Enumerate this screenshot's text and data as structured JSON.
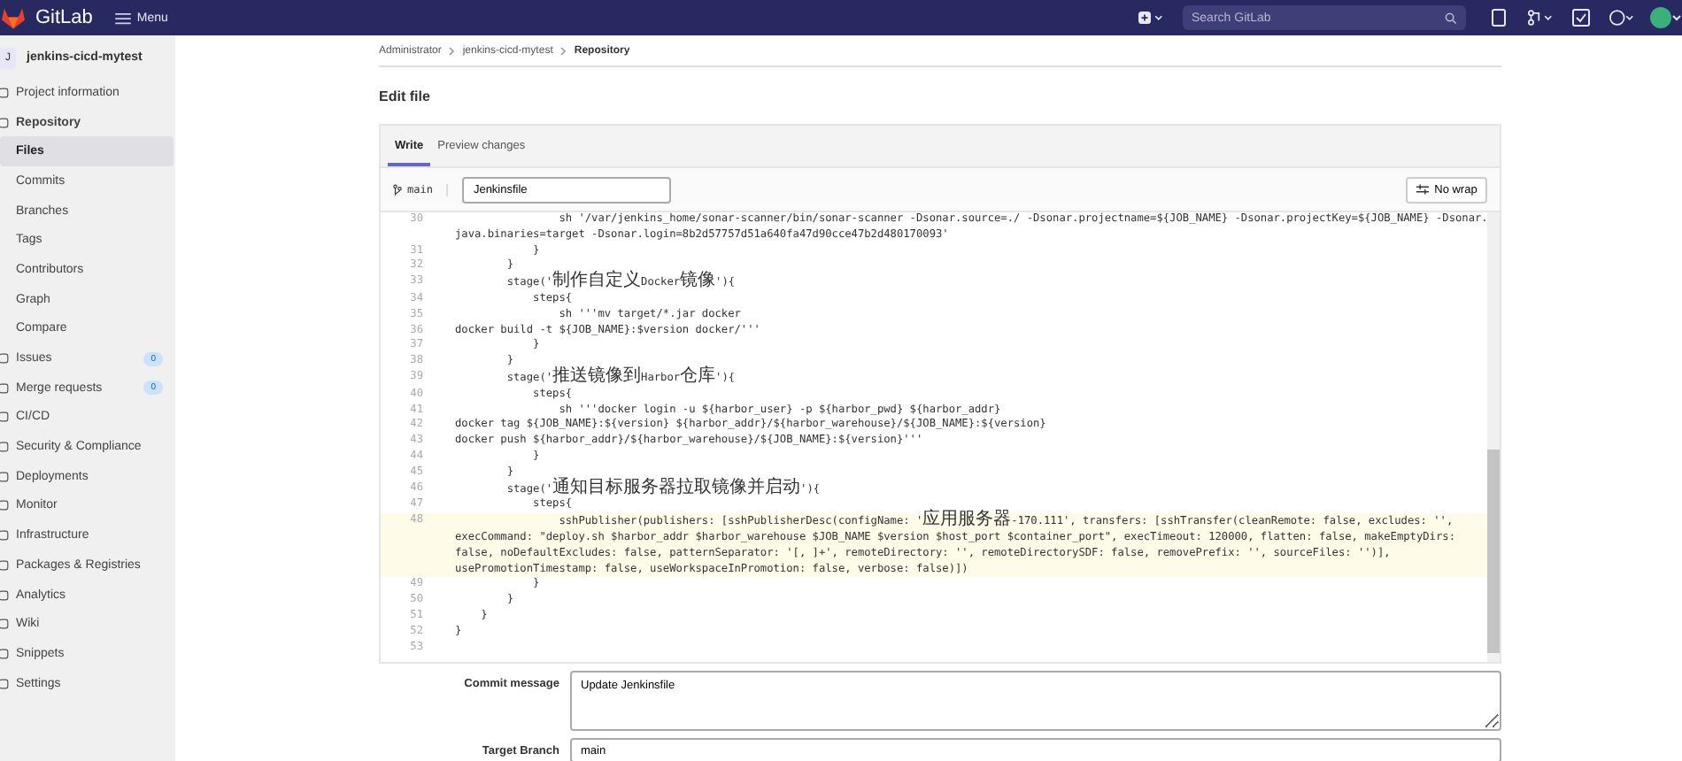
{
  "top_bar": {
    "brand": "GitLab",
    "menu": "Menu",
    "search": {
      "placeholder": "Search GitLab"
    }
  },
  "sidebar": {
    "project_avatar": "J",
    "project_name": "jenkins-cicd-mytest",
    "items": [
      {
        "label": "Project information",
        "kind": "section",
        "selected": false,
        "expanded": false
      },
      {
        "label": "Repository",
        "kind": "section",
        "selected": false,
        "expanded": true
      },
      {
        "label": "Files",
        "kind": "sub",
        "selected": true
      },
      {
        "label": "Commits",
        "kind": "sub",
        "selected": false
      },
      {
        "label": "Branches",
        "kind": "sub",
        "selected": false
      },
      {
        "label": "Tags",
        "kind": "sub",
        "selected": false
      },
      {
        "label": "Contributors",
        "kind": "sub",
        "selected": false
      },
      {
        "label": "Graph",
        "kind": "sub",
        "selected": false
      },
      {
        "label": "Compare",
        "kind": "sub",
        "selected": false
      },
      {
        "label": "Issues",
        "kind": "section",
        "selected": false,
        "expanded": false,
        "badge": "0"
      },
      {
        "label": "Merge requests",
        "kind": "section",
        "selected": false,
        "expanded": false,
        "badge": "0"
      },
      {
        "label": "CI/CD",
        "kind": "section",
        "selected": false,
        "expanded": false
      },
      {
        "label": "Security & Compliance",
        "kind": "section",
        "selected": false,
        "expanded": false
      },
      {
        "label": "Deployments",
        "kind": "section",
        "selected": false,
        "expanded": false
      },
      {
        "label": "Monitor",
        "kind": "section",
        "selected": false,
        "expanded": false
      },
      {
        "label": "Infrastructure",
        "kind": "section",
        "selected": false,
        "expanded": false
      },
      {
        "label": "Packages & Registries",
        "kind": "section",
        "selected": false,
        "expanded": false
      },
      {
        "label": "Analytics",
        "kind": "section",
        "selected": false,
        "expanded": false
      },
      {
        "label": "Wiki",
        "kind": "section",
        "selected": false,
        "expanded": false
      },
      {
        "label": "Snippets",
        "kind": "section",
        "selected": false,
        "expanded": false
      },
      {
        "label": "Settings",
        "kind": "section",
        "selected": false,
        "expanded": false
      }
    ]
  },
  "breadcrumb": [
    "Administrator",
    "jenkins-cicd-mytest",
    "Repository"
  ],
  "page_title": "Edit file",
  "editor": {
    "tabs": [
      {
        "label": "Write",
        "selected": true
      },
      {
        "label": "Preview changes",
        "selected": false
      }
    ],
    "branch": "main",
    "file_name": "Jenkinsfile",
    "wrap_button": "No wrap",
    "lines": [
      {
        "number": "30",
        "active": false,
        "segments": [
          "                sh '/var/jenkins_home/sonar-scanner/bin/sonar-scanner -Dsonar.source=./ -Dsonar.projectname=${JOB_NAME} -Dsonar.projectKey=${JOB_NAME} -Dsonar.",
          "java.binaries=target -Dsonar.login=8b2d57757d51a640fa47d90cce47b2d480170093'"
        ]
      },
      {
        "number": "31",
        "active": false,
        "segments": [
          "            }"
        ]
      },
      {
        "number": "32",
        "active": false,
        "segments": [
          "        }"
        ]
      },
      {
        "number": "33",
        "active": false,
        "segments": [
          "        stage('制作自定义Docker镜像'){"
        ]
      },
      {
        "number": "34",
        "active": false,
        "segments": [
          "            steps{"
        ]
      },
      {
        "number": "35",
        "active": false,
        "segments": [
          "                sh '''mv target/*.jar docker"
        ]
      },
      {
        "number": "36",
        "active": false,
        "segments": [
          "docker build -t ${JOB_NAME}:$version docker/'''"
        ]
      },
      {
        "number": "37",
        "active": false,
        "segments": [
          "            }"
        ]
      },
      {
        "number": "38",
        "active": false,
        "segments": [
          "        }"
        ]
      },
      {
        "number": "39",
        "active": false,
        "segments": [
          "        stage('推送镜像到Harbor仓库'){"
        ]
      },
      {
        "number": "40",
        "active": false,
        "segments": [
          "            steps{"
        ]
      },
      {
        "number": "41",
        "active": false,
        "segments": [
          "                sh '''docker login -u ${harbor_user} -p ${harbor_pwd} ${harbor_addr}"
        ]
      },
      {
        "number": "42",
        "active": false,
        "segments": [
          "docker tag ${JOB_NAME}:${version} ${harbor_addr}/${harbor_warehouse}/${JOB_NAME}:${version}"
        ]
      },
      {
        "number": "43",
        "active": false,
        "segments": [
          "docker push ${harbor_addr}/${harbor_warehouse}/${JOB_NAME}:${version}'''"
        ]
      },
      {
        "number": "44",
        "active": false,
        "segments": [
          "            }"
        ]
      },
      {
        "number": "45",
        "active": false,
        "segments": [
          "        }"
        ]
      },
      {
        "number": "46",
        "active": false,
        "segments": [
          "        stage('通知目标服务器拉取镜像并启动'){"
        ]
      },
      {
        "number": "47",
        "active": false,
        "segments": [
          "            steps{"
        ]
      },
      {
        "number": "48",
        "active": true,
        "segments": [
          "                sshPublisher(publishers: [sshPublisherDesc(configName: '应用服务器-170.111', transfers: [sshTransfer(cleanRemote: false, excludes: '',",
          "execCommand: \"deploy.sh $harbor_addr $harbor_warehouse $JOB_NAME $version $host_port $container_port\", execTimeout: 120000, flatten: false, makeEmptyDirs:",
          "false, noDefaultExcludes: false, patternSeparator: '[, ]+', remoteDirectory: '', remoteDirectorySDF: false, removePrefix: '', sourceFiles: '')],",
          "usePromotionTimestamp: false, useWorkspaceInPromotion: false, verbose: false)])"
        ]
      },
      {
        "number": "49",
        "active": false,
        "segments": [
          "            }"
        ]
      },
      {
        "number": "50",
        "active": false,
        "segments": [
          "        }"
        ]
      },
      {
        "number": "51",
        "active": false,
        "segments": [
          "    }"
        ]
      },
      {
        "number": "52",
        "active": false,
        "segments": [
          "}"
        ]
      },
      {
        "number": "53",
        "active": false
      }
    ]
  },
  "commit_message": {
    "label": "Commit message",
    "value": "Update Jenkinsfile"
  },
  "target_branch": {
    "label": "Target Branch",
    "value": "main"
  }
}
